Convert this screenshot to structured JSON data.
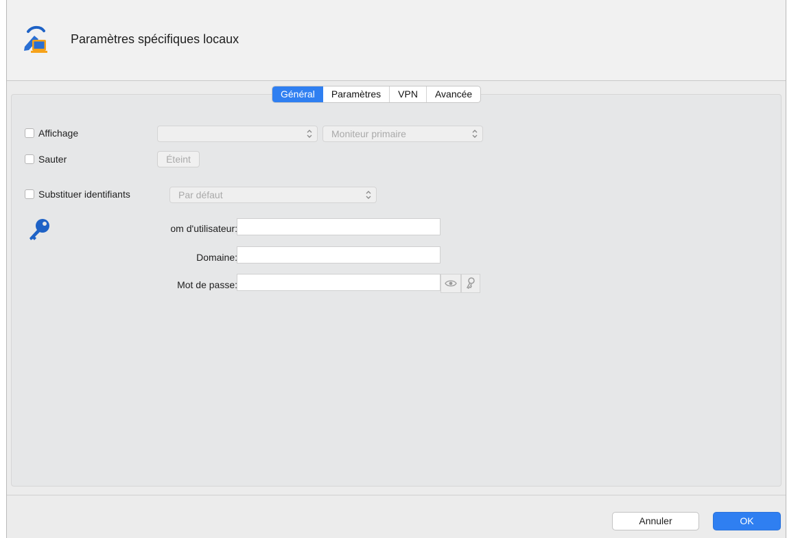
{
  "window": {
    "title": "Paramètres spécifiques locaux",
    "app_icon": "remote-desktop-icon"
  },
  "tabs": [
    {
      "label": "Général",
      "active": true
    },
    {
      "label": "Paramètres",
      "active": false
    },
    {
      "label": "VPN",
      "active": false
    },
    {
      "label": "Avancée",
      "active": false
    }
  ],
  "general": {
    "display": {
      "label": "Affichage",
      "checked": false,
      "select1_value": "",
      "select2_value": "Moniteur primaire"
    },
    "skip": {
      "label": "Sauter",
      "checked": false,
      "button_label": "Éteint"
    },
    "credentials": {
      "label": "Substituer identifiants",
      "checked": false,
      "select_value": "Par défaut",
      "icon": "key-icon",
      "username_label": "om d'utilisateur:",
      "username_value": "",
      "domain_label": "Domaine:",
      "domain_value": "",
      "password_label": "Mot de passe:",
      "password_value": "",
      "show_password_icon": "eye-icon",
      "key_icon": "key-small-icon"
    }
  },
  "footer": {
    "cancel_label": "Annuler",
    "ok_label": "OK"
  },
  "colors": {
    "accent": "#2f7ff1"
  }
}
